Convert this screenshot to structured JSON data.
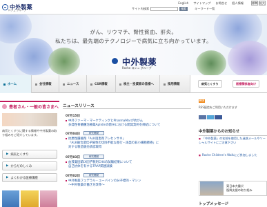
{
  "header": {
    "logo_text": "中外製薬",
    "logo_group": "ロシュ グループ",
    "util_links": [
      "English",
      "サイトマップ",
      "お問合せ",
      "個人情報",
      "ご利用にあたって",
      "ページ・画像 / 文字サイズ・拡大"
    ],
    "font_sizes": [
      "標準",
      "拡大"
    ],
    "search_label": "サイト内検索",
    "search_button": "検索",
    "search_link": "キーワード一覧"
  },
  "hero": {
    "line1": "がん、リウマチ、腎性貧血、肝炎。",
    "line2": "私たちは、最先端のテクノロジーで病気に立ち向かっています。",
    "logo_text": "中外製薬",
    "logo_group": "Roche ロシュ グループ"
  },
  "nav": {
    "items": [
      "ホーム",
      "会社情報",
      "ニュース",
      "CSR情報",
      "株主・投資家の皆様へ",
      "採用情報"
    ],
    "right_buttons": [
      "病気とくすり",
      "医療関係者向け"
    ]
  },
  "patients": {
    "title": "患者さん・一般の皆さまへ",
    "text": "病気とくすりに関する情報や中外製薬の取り組みをご紹介しています。",
    "buttons": [
      "病気とくすり",
      "からだのしくみ",
      "よくわかる医療講座"
    ]
  },
  "news": {
    "title": "ニュースリリース",
    "items": [
      {
        "date": "07月15日",
        "badge": "",
        "lines": [
          "中外ファーマ・マーケティングとPharmaMarが抗がん",
          "多発性骨髄腫治療薬Aplidinの欧州における開発契約を締結について"
        ]
      },
      {
        "date": "07月04日",
        "badge": "研究開発",
        "lines": [
          "抗悪性腫瘍剤「ALK阻害剤アレセンサ®」",
          "「ALK融合遺伝子陽性の切除不能な進行・再発の非小細胞肺癌」に",
          "対する製造販売承認取得"
        ]
      },
      {
        "date": "07月03日",
        "badge": "研究開発",
        "lines": [
          "血液凝固第IX因子製剤CH4の試験結果について",
          "自己抗体を有するTRAP関連試験"
        ]
      },
      {
        "date": "07月02日",
        "badge": "研究開発",
        "lines": [
          "中外製薬フェデラル・ユーバインの分子標的・マシン",
          "～中外製薬の働き方改革～"
        ]
      }
    ]
  },
  "right": {
    "rss_label": "RSS",
    "rss_text": "RSS配信をご利用いただけます",
    "section_title": "中外製薬からのお知らせ",
    "links": [
      "「中外製薬」の名前を使用した迷惑メールやソーシャルサイトにご注意下さい",
      "Roche Children's Walkにご参加しました"
    ],
    "quake_title": "東日本大震災",
    "quake_sub": "復興支援の取り組み",
    "top_message": "トップメッセージ"
  }
}
